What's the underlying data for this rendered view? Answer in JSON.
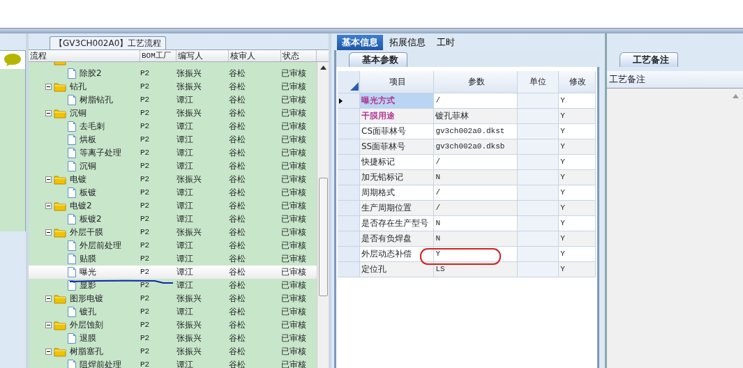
{
  "flow_panel": {
    "title": "【GV3CH002A0】工艺流程",
    "columns": [
      "流程",
      "BOM工厂",
      "编写人",
      "核审人",
      "状态"
    ],
    "tree": [
      {
        "kind": "folder",
        "children": [
          {
            "kind": "file",
            "label": "除胶2",
            "bom": "P2",
            "writer": "张振兴",
            "reviewer": "谷松",
            "status": "已审核",
            "selected": false
          }
        ]
      },
      {
        "kind": "folder",
        "label": "钻孔",
        "bom": "P2",
        "writer": "张振兴",
        "reviewer": "谷松",
        "status": "已审核",
        "expanded": true,
        "selected": false,
        "children": [
          {
            "kind": "file",
            "label": "树脂钻孔",
            "bom": "P2",
            "writer": "谭江",
            "reviewer": "谷松",
            "status": "已审核",
            "selected": false
          }
        ]
      },
      {
        "kind": "folder",
        "label": "沉铜",
        "bom": "P2",
        "writer": "张振兴",
        "reviewer": "谷松",
        "status": "已审核",
        "expanded": true,
        "selected": false,
        "children": [
          {
            "kind": "file",
            "label": "去毛刺",
            "bom": "P2",
            "writer": "谭江",
            "reviewer": "谷松",
            "status": "已审核",
            "selected": false
          },
          {
            "kind": "file",
            "label": "烘板",
            "bom": "P2",
            "writer": "谭江",
            "reviewer": "谷松",
            "status": "已审核",
            "selected": false
          },
          {
            "kind": "file",
            "label": "等离子处理",
            "bom": "P2",
            "writer": "谭江",
            "reviewer": "谷松",
            "status": "已审核",
            "selected": false
          },
          {
            "kind": "file",
            "label": "沉铜",
            "bom": "P2",
            "writer": "谭江",
            "reviewer": "谷松",
            "status": "已审核",
            "selected": false
          }
        ]
      },
      {
        "kind": "folder",
        "label": "电镀",
        "bom": "P2",
        "writer": "张振兴",
        "reviewer": "谷松",
        "status": "已审核",
        "expanded": true,
        "selected": false,
        "children": [
          {
            "kind": "file",
            "label": "板镀",
            "bom": "P2",
            "writer": "谭江",
            "reviewer": "谷松",
            "status": "已审核",
            "selected": false
          }
        ]
      },
      {
        "kind": "folder",
        "label": "电镀2",
        "bom": "P2",
        "writer": "谭江",
        "reviewer": "谷松",
        "status": "已审核",
        "expanded": true,
        "selected": false,
        "children": [
          {
            "kind": "file",
            "label": "板镀2",
            "bom": "P2",
            "writer": "谭江",
            "reviewer": "谷松",
            "status": "已审核",
            "selected": false
          }
        ]
      },
      {
        "kind": "folder",
        "label": "外层干膜",
        "bom": "P2",
        "writer": "张振兴",
        "reviewer": "谷松",
        "status": "已审核",
        "expanded": true,
        "selected": false,
        "children": [
          {
            "kind": "file",
            "label": "外层前处理",
            "bom": "P2",
            "writer": "谭江",
            "reviewer": "谷松",
            "status": "已审核",
            "selected": false
          },
          {
            "kind": "file",
            "label": "贴膜",
            "bom": "P2",
            "writer": "谭江",
            "reviewer": "谷松",
            "status": "已审核",
            "selected": false
          },
          {
            "kind": "file",
            "label": "曝光",
            "bom": "P2",
            "writer": "谭江",
            "reviewer": "谷松",
            "status": "已审核",
            "selected": true
          },
          {
            "kind": "file",
            "label": "显影",
            "bom": "P2",
            "writer": "谭江",
            "reviewer": "谷松",
            "status": "已审核",
            "selected": false
          }
        ]
      },
      {
        "kind": "folder",
        "label": "图形电镀",
        "bom": "P2",
        "writer": "张振兴",
        "reviewer": "谷松",
        "status": "已审核",
        "expanded": true,
        "selected": false,
        "children": [
          {
            "kind": "file",
            "label": "镀孔",
            "bom": "P2",
            "writer": "谭江",
            "reviewer": "谷松",
            "status": "已审核",
            "selected": false
          }
        ]
      },
      {
        "kind": "folder",
        "label": "外层蚀刻",
        "bom": "P2",
        "writer": "张振兴",
        "reviewer": "谷松",
        "status": "已审核",
        "expanded": true,
        "selected": false,
        "children": [
          {
            "kind": "file",
            "label": "退膜",
            "bom": "P2",
            "writer": "张振兴",
            "reviewer": "谷松",
            "status": "已审核",
            "selected": false
          }
        ]
      },
      {
        "kind": "folder",
        "label": "树脂塞孔",
        "bom": "P2",
        "writer": "张振兴",
        "reviewer": "谷松",
        "status": "已审核",
        "expanded": true,
        "selected": false,
        "children": [
          {
            "kind": "file",
            "label": "阻焊前处理",
            "bom": "P2",
            "writer": "谭江",
            "reviewer": "谷松",
            "status": "已审核",
            "selected": false
          }
        ]
      }
    ]
  },
  "info_panel": {
    "tabs": [
      {
        "label": "基本信息",
        "selected": true
      },
      {
        "label": "拓展信息",
        "selected": false
      },
      {
        "label": "工时",
        "selected": false
      }
    ],
    "subtab": "基本参数",
    "columns": [
      "项目",
      "参数",
      "单位",
      "修改"
    ],
    "rows": [
      {
        "item": "曝光方式",
        "param": "/",
        "modify": "Y",
        "selected": true,
        "color": "#b0288a"
      },
      {
        "item": "干膜用途",
        "param": "镀孔菲林",
        "modify": "Y",
        "selected": false,
        "color": "#b0288a"
      },
      {
        "item": "CS面菲林号",
        "param": "gv3ch002a0.dkst",
        "modify": "Y",
        "selected": false
      },
      {
        "item": "SS面菲林号",
        "param": "gv3ch002a0.dksb",
        "modify": "Y",
        "selected": false
      },
      {
        "item": "快捷标记",
        "param": "/",
        "modify": "Y",
        "selected": false
      },
      {
        "item": "加无铅标记",
        "param": "N",
        "modify": "Y",
        "selected": false
      },
      {
        "item": "周期格式",
        "param": "/",
        "modify": "Y",
        "selected": false
      },
      {
        "item": "生产周期位置",
        "param": "/",
        "modify": "Y",
        "selected": false
      },
      {
        "item": "是否存在生产型号",
        "param": "N",
        "modify": "Y",
        "selected": false
      },
      {
        "item": "是否有负焊盘",
        "param": "N",
        "modify": "Y",
        "selected": false
      },
      {
        "item": "外层动态补偿",
        "param": "Y",
        "modify": "Y",
        "selected": false
      },
      {
        "item": "定位孔",
        "param": "LS",
        "modify": "Y",
        "selected": false
      }
    ]
  },
  "notes_panel": {
    "tab": "工艺备注",
    "header": "工艺备注"
  }
}
